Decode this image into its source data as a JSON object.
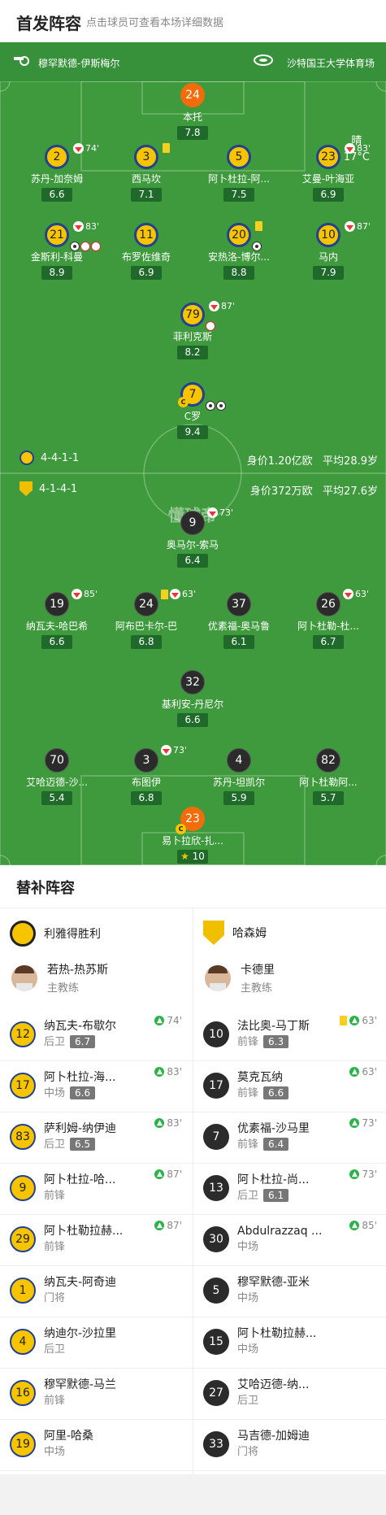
{
  "header": {
    "title": "首发阵容",
    "subtitle": "点击球员可查看本场详细数据"
  },
  "venue": {
    "referee": "穆罕默德-伊斯梅尔",
    "stadium": "沙特国王大学体育场"
  },
  "weather": {
    "condition": "晴",
    "temp": "17°C"
  },
  "home": {
    "formation": "4-4-1-1",
    "value": "身价1.20亿欧",
    "age": "平均28.9岁",
    "players": [
      {
        "num": "24",
        "name": "本托",
        "rating": "7.8"
      },
      {
        "num": "2",
        "name": "苏丹-加奈姆",
        "rating": "6.6",
        "sub": "74'"
      },
      {
        "num": "3",
        "name": "西马坎",
        "rating": "7.1"
      },
      {
        "num": "5",
        "name": "阿卜杜拉-阿...",
        "rating": "7.5"
      },
      {
        "num": "23",
        "name": "艾曼-叶海亚",
        "rating": "6.9",
        "sub": "83'"
      },
      {
        "num": "21",
        "name": "金斯利-科曼",
        "rating": "8.9",
        "sub": "83'"
      },
      {
        "num": "11",
        "name": "布罗佐维奇",
        "rating": "6.9"
      },
      {
        "num": "20",
        "name": "安热洛-博尔...",
        "rating": "8.8"
      },
      {
        "num": "10",
        "name": "马内",
        "rating": "7.9",
        "sub": "87'"
      },
      {
        "num": "79",
        "name": "菲利克斯",
        "rating": "8.2",
        "sub": "87'"
      },
      {
        "num": "7",
        "name": "C罗",
        "rating": "9.4"
      }
    ]
  },
  "away": {
    "formation": "4-1-4-1",
    "value": "身价372万欧",
    "age": "平均27.6岁",
    "players": [
      {
        "num": "9",
        "name": "奥马尔-索马",
        "rating": "6.4",
        "sub": "73'"
      },
      {
        "num": "19",
        "name": "纳瓦夫-哈巴希",
        "rating": "6.6",
        "sub": "85'"
      },
      {
        "num": "24",
        "name": "阿布巴卡尔-巴",
        "rating": "6.8",
        "sub": "63'"
      },
      {
        "num": "37",
        "name": "优素福-奥马鲁",
        "rating": "6.1"
      },
      {
        "num": "26",
        "name": "阿卜杜勒-杜...",
        "rating": "6.7",
        "sub": "63'"
      },
      {
        "num": "32",
        "name": "基利安-丹尼尔",
        "rating": "6.6"
      },
      {
        "num": "70",
        "name": "艾哈迈德-沙...",
        "rating": "5.4"
      },
      {
        "num": "3",
        "name": "布图伊",
        "rating": "6.8",
        "sub": "73'"
      },
      {
        "num": "4",
        "name": "苏丹-坦凯尔",
        "rating": "5.9"
      },
      {
        "num": "82",
        "name": "阿卜杜勒阿...",
        "rating": "5.7"
      },
      {
        "num": "23",
        "name": "易卜拉欣-扎...",
        "rating": "10"
      }
    ]
  },
  "watermark": "懂球帝",
  "subs": {
    "title": "替补阵容",
    "home_team": "利雅得胜利",
    "away_team": "哈森姆",
    "home_coach": {
      "name": "若热-热苏斯",
      "role": "主教练"
    },
    "away_coach": {
      "name": "卡德里",
      "role": "主教练"
    },
    "home": [
      {
        "num": "12",
        "name": "纳瓦夫-布歇尔",
        "pos": "后卫",
        "rating": "6.7",
        "time": "74'"
      },
      {
        "num": "17",
        "name": "阿卜杜拉-海...",
        "pos": "中场",
        "rating": "6.6",
        "time": "83'"
      },
      {
        "num": "83",
        "name": "萨利姆-纳伊迪",
        "pos": "后卫",
        "rating": "6.5",
        "time": "83'"
      },
      {
        "num": "9",
        "name": "阿卜杜拉-哈...",
        "pos": "前锋",
        "rating": "",
        "time": "87'"
      },
      {
        "num": "29",
        "name": "阿卜杜勒拉赫...",
        "pos": "前锋",
        "rating": "",
        "time": "87'"
      },
      {
        "num": "1",
        "name": "纳瓦夫-阿奇迪",
        "pos": "门将",
        "rating": "",
        "time": ""
      },
      {
        "num": "4",
        "name": "纳迪尔-沙拉里",
        "pos": "后卫",
        "rating": "",
        "time": ""
      },
      {
        "num": "16",
        "name": "穆罕默德-马兰",
        "pos": "前锋",
        "rating": "",
        "time": ""
      },
      {
        "num": "19",
        "name": "阿里-哈桑",
        "pos": "中场",
        "rating": "",
        "time": ""
      }
    ],
    "away": [
      {
        "num": "10",
        "name": "法比奥-马丁斯",
        "pos": "前锋",
        "rating": "6.3",
        "time": "63'"
      },
      {
        "num": "17",
        "name": "莫克瓦纳",
        "pos": "前锋",
        "rating": "6.6",
        "time": "63'"
      },
      {
        "num": "7",
        "name": "优素福-沙马里",
        "pos": "前锋",
        "rating": "6.4",
        "time": "73'"
      },
      {
        "num": "13",
        "name": "阿卜杜拉-尚...",
        "pos": "后卫",
        "rating": "6.1",
        "time": "73'"
      },
      {
        "num": "30",
        "name": "Abdulrazzaq ...",
        "pos": "中场",
        "rating": "",
        "time": "85'"
      },
      {
        "num": "5",
        "name": "穆罕默德-亚米",
        "pos": "中场",
        "rating": "",
        "time": ""
      },
      {
        "num": "15",
        "name": "阿卜杜勒拉赫...",
        "pos": "中场",
        "rating": "",
        "time": ""
      },
      {
        "num": "27",
        "name": "艾哈迈德-纳...",
        "pos": "后卫",
        "rating": "",
        "time": ""
      },
      {
        "num": "33",
        "name": "马吉德-加姆迪",
        "pos": "门将",
        "rating": "",
        "time": ""
      }
    ]
  }
}
